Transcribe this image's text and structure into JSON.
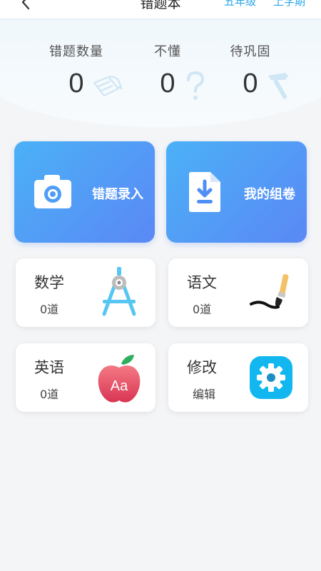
{
  "header": {
    "title": "错题本",
    "grade": "五年级",
    "term": "上学期"
  },
  "stats": [
    {
      "label": "错题数量",
      "value": "0",
      "icon": "scroll-icon"
    },
    {
      "label": "不懂",
      "value": "0",
      "icon": "question-icon"
    },
    {
      "label": "待巩固",
      "value": "0",
      "icon": "hammer-icon"
    }
  ],
  "actions": [
    {
      "label": "错题录入",
      "icon": "camera-icon"
    },
    {
      "label": "我的组卷",
      "icon": "download-doc-icon"
    }
  ],
  "subjects": [
    {
      "name": "数学",
      "count": "0道",
      "icon": "compass-icon"
    },
    {
      "name": "语文",
      "count": "0道",
      "icon": "brush-icon"
    },
    {
      "name": "英语",
      "count": "0道",
      "icon": "apple-icon",
      "icon_text": "Aa"
    },
    {
      "name": "修改",
      "count": "编辑",
      "icon": "gear-icon"
    }
  ],
  "colors": {
    "accent": "#2aa7e8",
    "card_gradient_start": "#4bb1f7",
    "card_gradient_end": "#5a88f5"
  }
}
